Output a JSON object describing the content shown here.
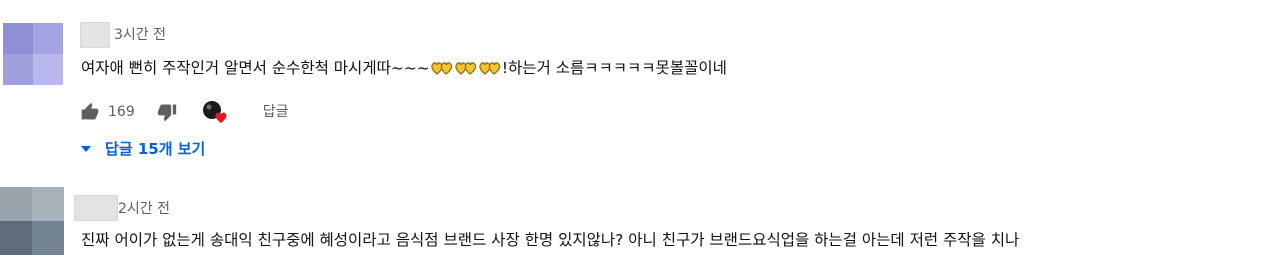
{
  "comments": [
    {
      "timestamp": "3시간 전",
      "text_before": "여자애 뻔히 주작인거 알면서 순수한척 마시게따~~~",
      "text_after": "!하는거 소름ㅋㅋㅋㅋㅋ못볼꼴이네",
      "like_count": "169",
      "reply_label": "답글",
      "view_replies_label": "답글 15개 보기",
      "avatar_colors": [
        "#8f8fd6",
        "#a4a4e2",
        "#a0a0dc",
        "#b8b8ec"
      ],
      "emoji": "two-hearts-emoji",
      "emoji_count": 3
    },
    {
      "timestamp": "2시간 전",
      "text": "진짜 어이가 없는게 송대익 친구중에 혜성이라고 음식점 브랜드 사장 한명 있지않나? 아니 친구가 브랜드요식업을 하는걸 아는데 저런 주작을 치나",
      "avatar_colors": [
        "#9aa4ad",
        "#a8b2bb",
        "#5d6b7b",
        "#748393"
      ]
    }
  ],
  "icons": {
    "like": "thumbs-up-icon",
    "dislike": "thumbs-down-icon",
    "creator_heart": "creator-heart-icon",
    "expand": "caret-down-icon"
  },
  "colors": {
    "link_blue": "#065fd4",
    "meta_gray": "#606060",
    "heart_red": "#e01b1b"
  }
}
